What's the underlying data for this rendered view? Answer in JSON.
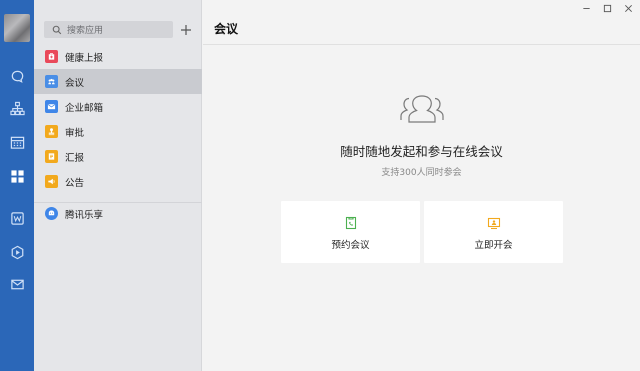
{
  "window": {
    "title": "会议"
  },
  "search": {
    "placeholder": "搜索应用"
  },
  "apps": [
    {
      "label": "健康上报",
      "icon": "health-report-icon",
      "color": "#e9495a",
      "active": false
    },
    {
      "label": "会议",
      "icon": "meeting-icon",
      "color": "#4a8ee6",
      "active": true
    },
    {
      "label": "企业邮箱",
      "icon": "mail-icon",
      "color": "#3f86e8",
      "active": false
    },
    {
      "label": "审批",
      "icon": "approval-icon",
      "color": "#f2a91d",
      "active": false
    },
    {
      "label": "汇报",
      "icon": "report-icon",
      "color": "#f2a91d",
      "active": false
    },
    {
      "label": "公告",
      "icon": "announcement-icon",
      "color": "#f2a91d",
      "active": false
    },
    {
      "label": "腾讯乐享",
      "icon": "lexiang-icon",
      "color": "#3f86e8",
      "active": false
    }
  ],
  "main": {
    "hero_title": "随时随地发起和参与在线会议",
    "hero_subtitle": "支持300人同时参会",
    "cards": [
      {
        "label": "预约会议",
        "icon": "schedule-meeting-icon",
        "color": "#4cb050"
      },
      {
        "label": "立即开会",
        "icon": "start-meeting-icon",
        "color": "#f2a91d"
      }
    ]
  },
  "rail": {
    "icons": [
      "chat-icon",
      "contacts-icon",
      "calendar-icon",
      "workbench-icon",
      "docs-icon",
      "drive-icon",
      "email-icon"
    ],
    "color": "#2b67b8"
  }
}
